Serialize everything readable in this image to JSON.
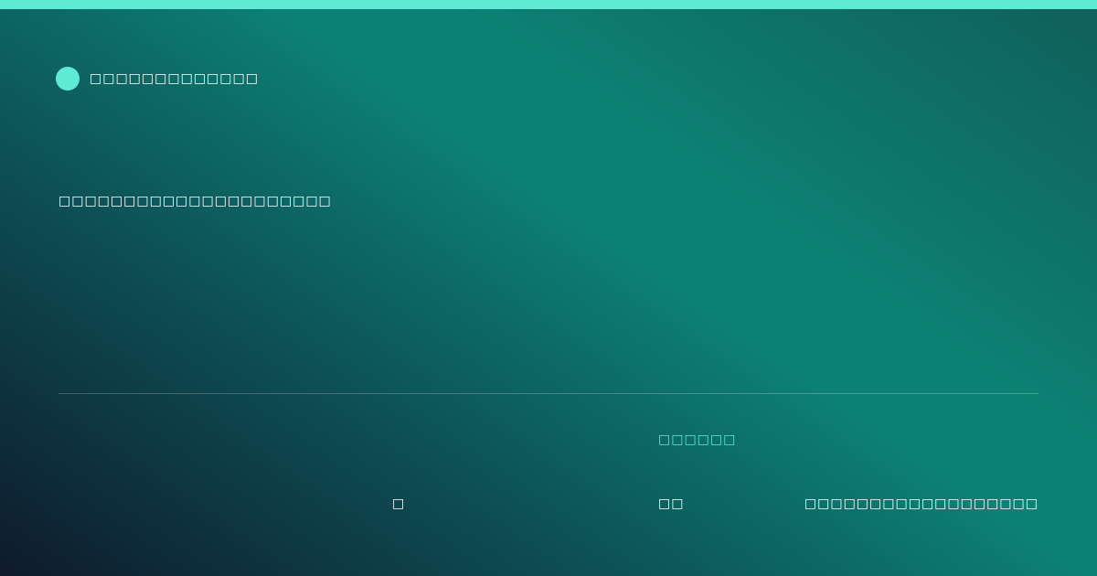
{
  "header": {
    "brand_name": "□□□□□□□□□□□□□"
  },
  "main": {
    "headline": "□□□□□□□□□□□□□□□□□□□□□"
  },
  "footer": {
    "stat_label": "□□□□□□",
    "left_value": "□",
    "mid_value": "□□",
    "right_text": "□□□□□□□□□□□□□□□□□□"
  },
  "colors": {
    "accent": "#5eead4",
    "background_dark": "#0f1a2b",
    "background_teal": "#0d8175"
  }
}
